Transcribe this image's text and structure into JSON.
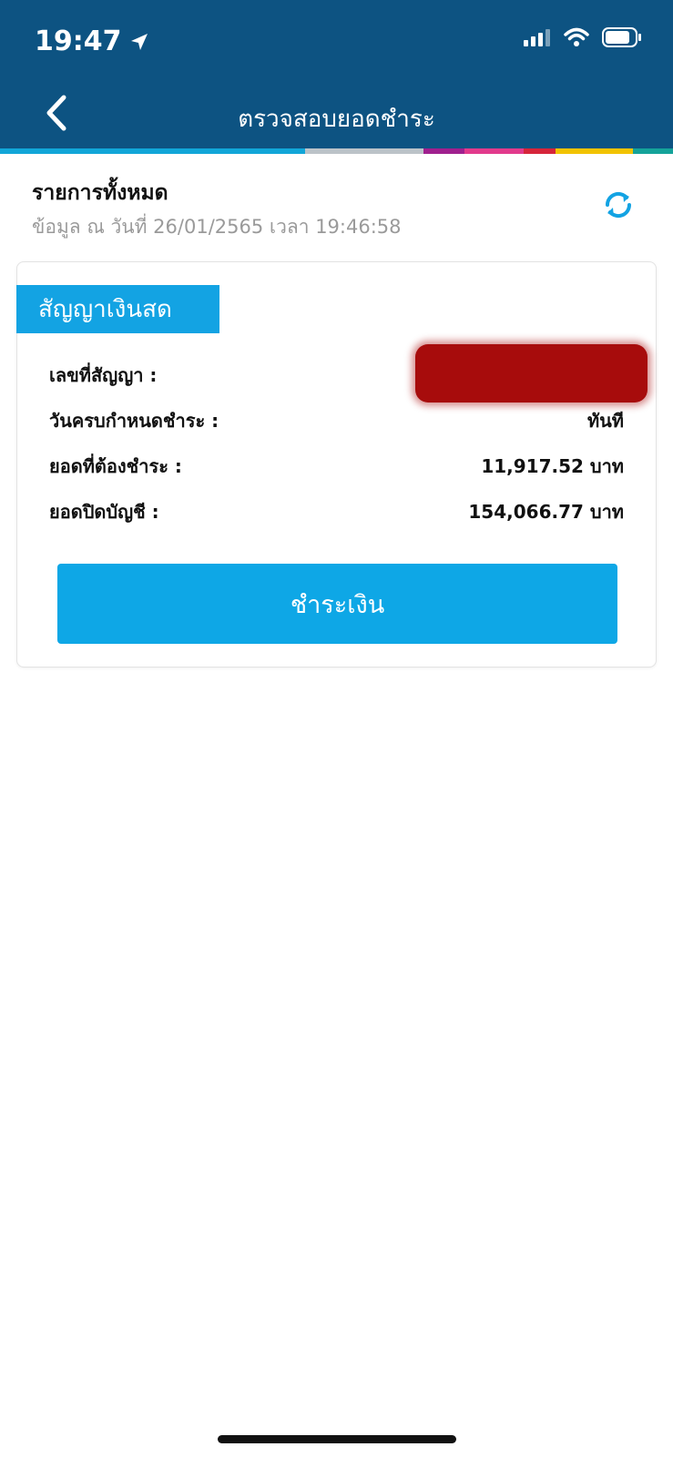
{
  "status_bar": {
    "time": "19:47"
  },
  "header": {
    "title": "ตรวจสอบยอดชำระ"
  },
  "summary": {
    "title": "รายการทั้งหมด",
    "subtitle": "ข้อมูล ณ วันที่ 26/01/2565 เวลา 19:46:58"
  },
  "card": {
    "tag": "สัญญาเงินสด",
    "rows": [
      {
        "label": "เลขที่สัญญา :",
        "value": ""
      },
      {
        "label": "วันครบกำหนดชำระ :",
        "value": "ทันที"
      },
      {
        "label": "ยอดที่ต้องชำระ :",
        "value": "11,917.52 บาท"
      },
      {
        "label": "ยอดปิดบัญชี :",
        "value": "154,066.77 บาท"
      }
    ],
    "pay_button": "ชำระเงิน"
  },
  "colors": {
    "header_bg": "#0d5382",
    "accent": "#13a3e3",
    "button_bg": "#0ea7e6",
    "redaction": "#a70c0c"
  },
  "icons": [
    "location-arrow-icon",
    "signal-icon",
    "wifi-icon",
    "battery-icon",
    "back-chevron-icon",
    "refresh-icon"
  ]
}
